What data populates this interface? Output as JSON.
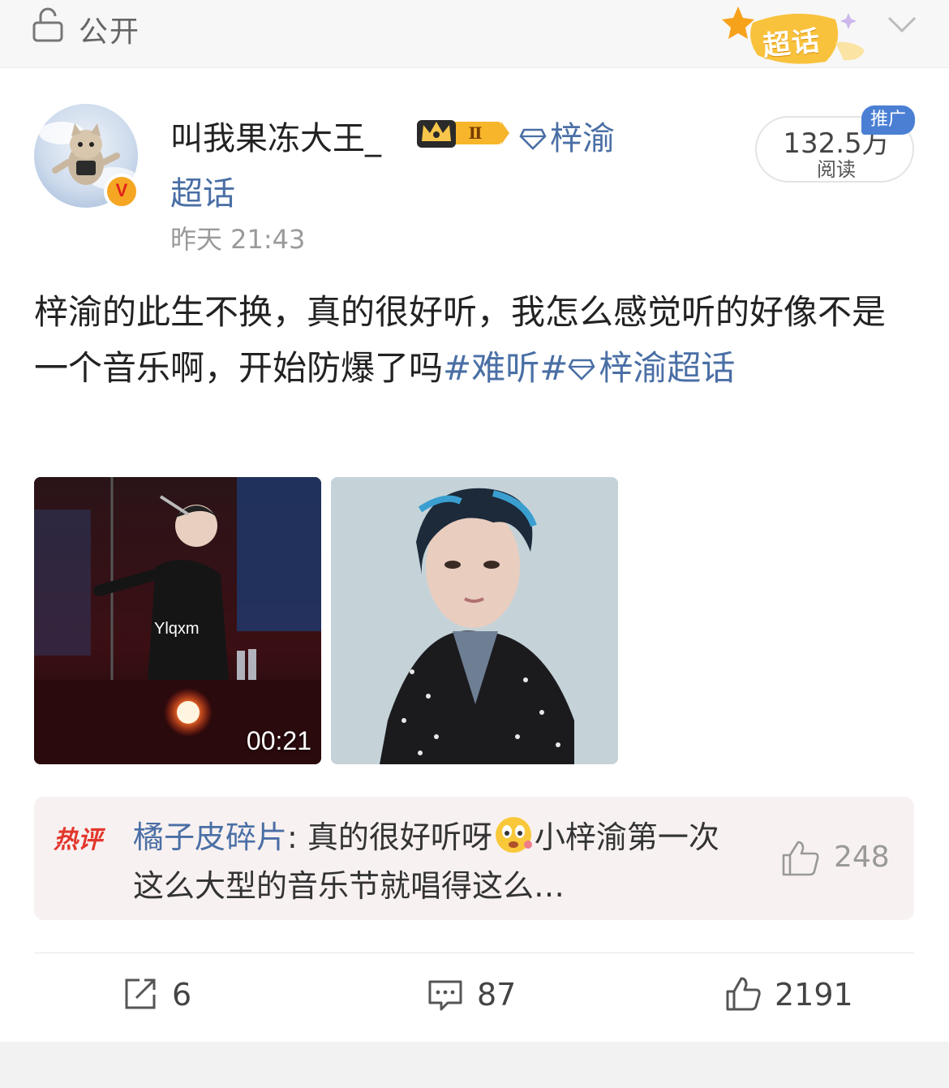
{
  "topbar": {
    "visibility": "公开",
    "supertopic_badge": "超话"
  },
  "post": {
    "username": "叫我果冻大王_",
    "level_badge": "Ⅱ",
    "topic_link_part1": "梓渝",
    "topic_link_part2": "超话",
    "time": "昨天 21:43",
    "read_count": "132.5万",
    "read_label": "阅读",
    "promo_tag": "推广",
    "text_main": "梓渝的此生不换，真的很好听，我怎么感觉听的好像不是一个音乐啊，开始防爆了吗",
    "hashtag": "#难听#",
    "topic_tag": "梓渝超话"
  },
  "media": {
    "video_watermark": "Ylqxm",
    "video_duration": "00:21"
  },
  "hot_comment": {
    "label": "热评",
    "user": "橘子皮碎片",
    "separator": ": ",
    "text_part1": "真的很好听呀",
    "text_part2": "小梓渝第一次这么大型的音乐节就唱得这么…",
    "like_count": "248"
  },
  "actions": {
    "repost_count": "6",
    "comment_count": "87",
    "like_count": "2191"
  },
  "colors": {
    "link": "#4a6fa5",
    "hot_label": "#e2372c",
    "badge_gold": "#f5a623"
  }
}
